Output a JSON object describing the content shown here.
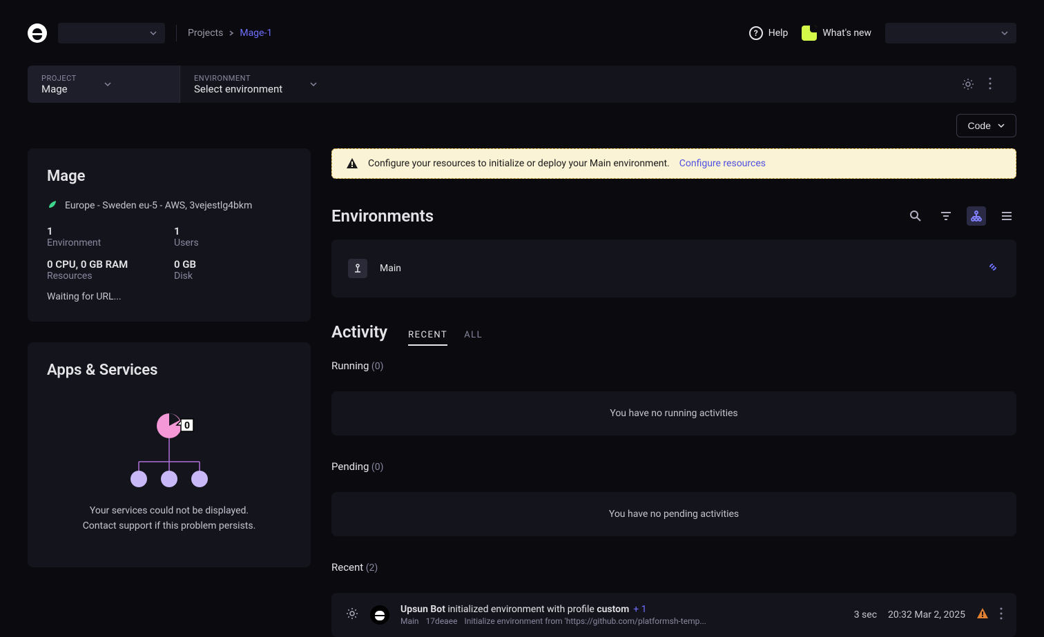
{
  "header": {
    "breadcrumb_root": "Projects",
    "breadcrumb_current": "Mage-1",
    "help_label": "Help",
    "whatsnew_label": "What's new"
  },
  "subheader": {
    "project_label": "PROJECT",
    "project_value": "Mage",
    "env_label": "ENVIRONMENT",
    "env_value": "Select environment"
  },
  "code_btn": "Code",
  "project_card": {
    "title": "Mage",
    "region": "Europe - Sweden eu-5 - AWS, 3vejestlg4bkm",
    "env_count": "1",
    "env_label": "Environment",
    "users_count": "1",
    "users_label": "Users",
    "resources": "0 CPU, 0 GB RAM",
    "resources_label": "Resources",
    "disk": "0 GB",
    "disk_label": "Disk",
    "url_status": "Waiting for URL..."
  },
  "apps_card": {
    "title": "Apps & Services",
    "badge_count": "0",
    "error1": "Your services could not be displayed.",
    "error2": "Contact support if this problem persists."
  },
  "banner": {
    "text": "Configure your resources to initialize or deploy your Main environment.",
    "link": "Configure resources"
  },
  "environments": {
    "title": "Environments",
    "main": "Main"
  },
  "activity": {
    "title": "Activity",
    "tab_recent": "RECENT",
    "tab_all": "ALL",
    "running_label": "Running",
    "running_count": "(0)",
    "running_empty": "You have no running activities",
    "pending_label": "Pending",
    "pending_count": "(0)",
    "pending_empty": "You have no pending activities",
    "recent_label": "Recent",
    "recent_count": "(2)",
    "item1": {
      "actor": "Upsun Bot",
      "action_mid": " initialized environment  with profile ",
      "profile": "custom",
      "plus": "+ 1",
      "branch": "Main",
      "hash": "17deaee",
      "desc": "Initialize environment from 'https://github.com/platformsh-temp...",
      "duration": "3 sec",
      "timestamp": "20:32 Mar 2, 2025"
    }
  }
}
